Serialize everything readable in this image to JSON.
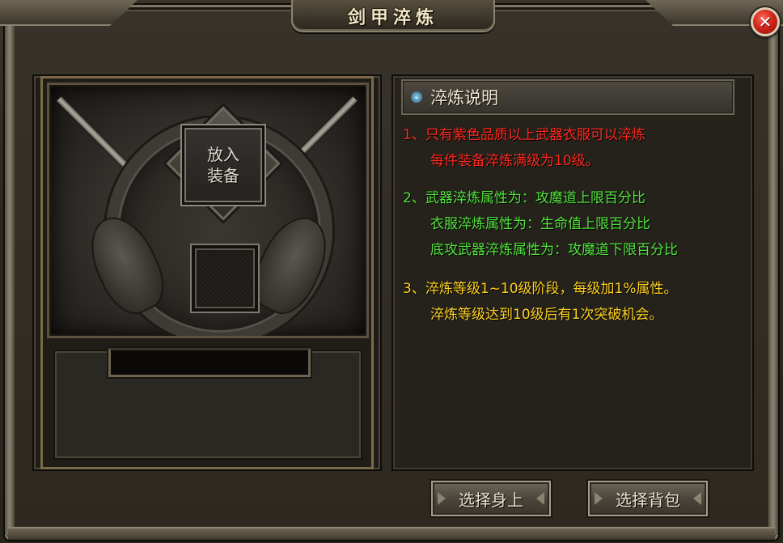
{
  "window": {
    "title": "剑甲淬炼",
    "close_symbol": "✕"
  },
  "left": {
    "equip_slot_text": [
      "放入",
      "装备"
    ]
  },
  "right": {
    "header": "淬炼说明",
    "header_icon": "chevron-down-icon",
    "lines": [
      {
        "text": "1、只有紫色品质以上武器衣服可以淬炼",
        "color": "red"
      },
      {
        "text": "每件装备淬炼满级为10级。",
        "color": "red"
      },
      {
        "text": "2、武器淬炼属性为：攻魔道上限百分比",
        "color": "green"
      },
      {
        "text": "衣服淬炼属性为：生命值上限百分比",
        "color": "green"
      },
      {
        "text": "底攻武器淬炼属性为：攻魔道下限百分比",
        "color": "green"
      },
      {
        "text": "3、淬炼等级1~10级阶段，每级加1%属性。",
        "color": "yellow"
      },
      {
        "text": "淬炼等级达到10级后有1次突破机会。",
        "color": "yellow"
      }
    ]
  },
  "buttons": {
    "select_body": "选择身上",
    "select_bag": "选择背包"
  },
  "colors": {
    "red": "#ff2a1f",
    "green": "#52e43c",
    "yellow": "#ffd21f",
    "title": "#f1e6c6"
  }
}
